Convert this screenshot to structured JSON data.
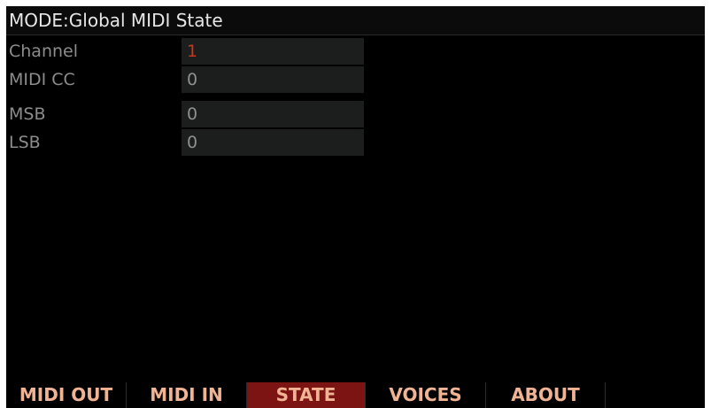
{
  "mode_title": "MODE:Global MIDI State",
  "parameters": [
    {
      "label": "Channel",
      "value": "1"
    },
    {
      "label": "MIDI CC",
      "value": "0"
    },
    {
      "label": "MSB",
      "value": "0"
    },
    {
      "label": "LSB",
      "value": "0"
    }
  ],
  "tabs": [
    {
      "label": "MIDI OUT"
    },
    {
      "label": "MIDI IN"
    },
    {
      "label": "STATE"
    },
    {
      "label": "VOICES"
    },
    {
      "label": "ABOUT"
    },
    {
      "label": ""
    }
  ],
  "colors": {
    "active_value": "#c8361c",
    "selected_tab": "#7c1414",
    "tab_text": "#f0b393"
  }
}
